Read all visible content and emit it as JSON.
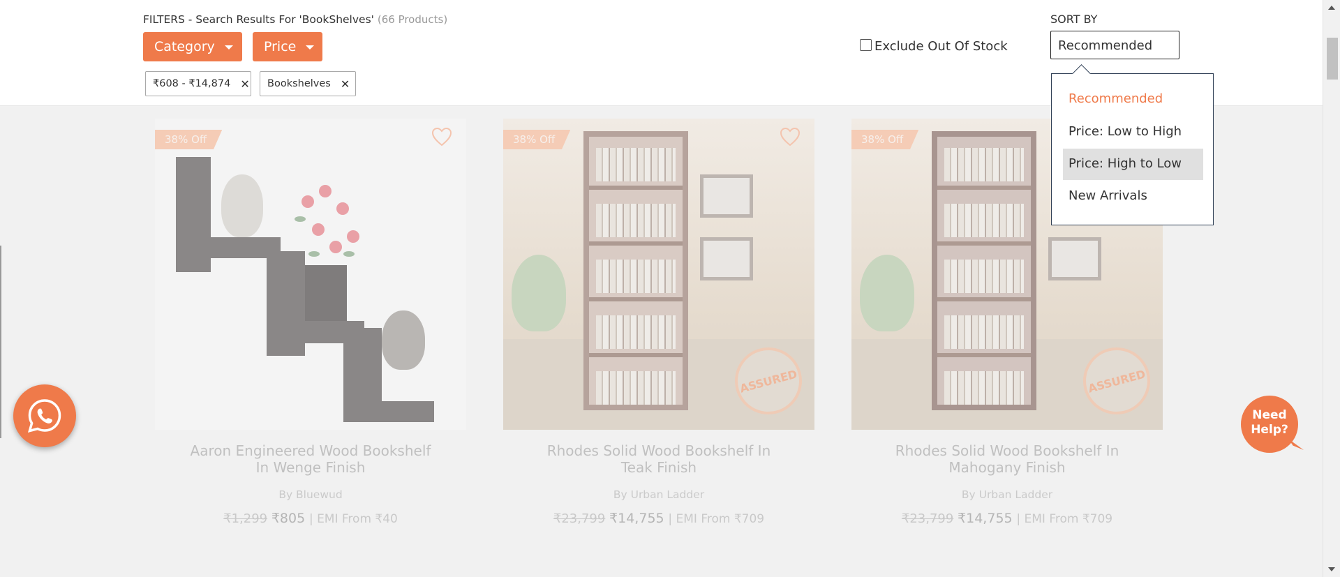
{
  "filters": {
    "title": "FILTERS - Search Results For 'BookShelves'",
    "count": "(66 Products)",
    "category_label": "Category",
    "price_label": "Price",
    "chips": [
      {
        "label": "₹608 - ₹14,874"
      },
      {
        "label": "Bookshelves"
      }
    ],
    "exclude_out_of_stock": "Exclude Out Of Stock"
  },
  "sort": {
    "label": "SORT BY",
    "selected": "Recommended",
    "options": [
      "Recommended",
      "Price: Low to High",
      "Price: High to Low",
      "New Arrivals"
    ],
    "highlighted": "Price: High to Low"
  },
  "products": [
    {
      "discount": "38% Off",
      "name": "Aaron Engineered Wood Bookshelf In Wenge Finish",
      "brand": "By Bluewud",
      "mrp": "₹1,299",
      "price": "₹805",
      "emi": "| EMI From ₹40"
    },
    {
      "discount": "38% Off",
      "name": "Rhodes Solid Wood Bookshelf In Teak Finish",
      "brand": "By Urban Ladder",
      "mrp": "₹23,799",
      "price": "₹14,755",
      "emi": "| EMI From ₹709",
      "badge": "ASSURED"
    },
    {
      "discount": "38% Off",
      "name": "Rhodes Solid Wood Bookshelf In Mahogany Finish",
      "brand": "By Urban Ladder",
      "mrp": "₹23,799",
      "price": "₹14,755",
      "emi": "| EMI From ₹709",
      "badge": "ASSURED"
    }
  ],
  "help": {
    "line1": "Need",
    "line2": "Help?"
  },
  "colors": {
    "accent": "#ef7a4a",
    "overlay": "#f1f1f1",
    "menu_border": "#2f3f55"
  },
  "icons": [
    "caret-down-icon",
    "close-icon",
    "heart-icon",
    "whatsapp-icon"
  ]
}
